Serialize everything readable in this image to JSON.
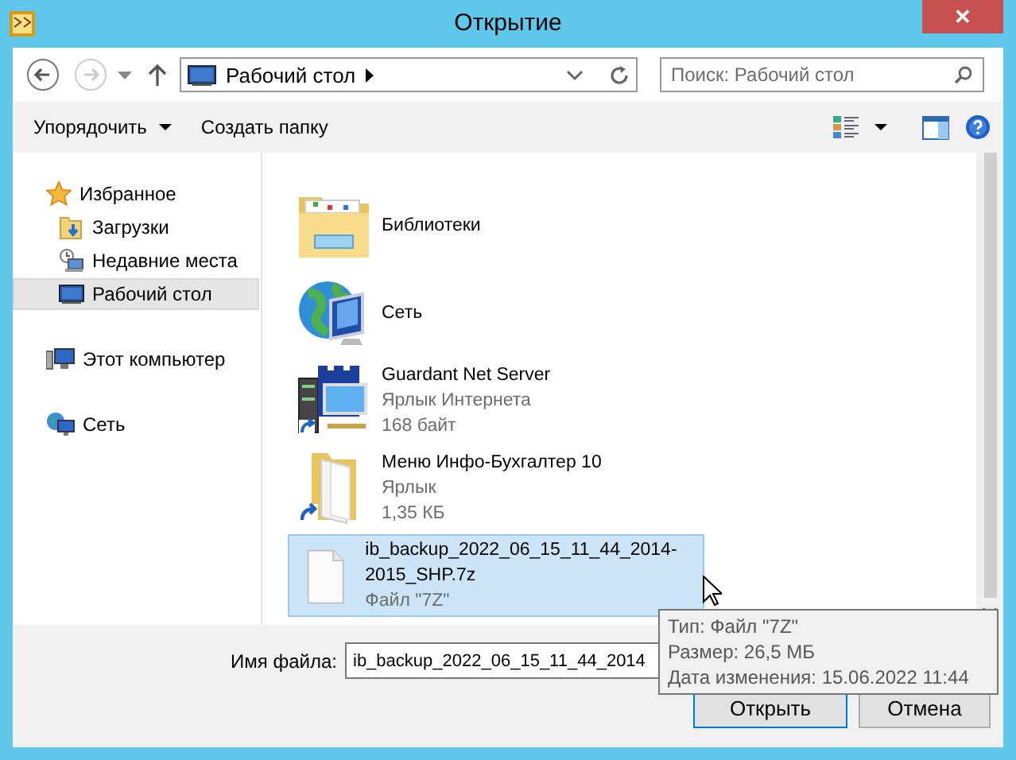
{
  "window": {
    "title": "Открытие",
    "close": "✕"
  },
  "nav": {
    "path": "Рабочий стол",
    "search": {
      "placeholder": "Поиск: Рабочий стол"
    }
  },
  "toolbar": {
    "organize": "Упорядочить",
    "new_folder": "Создать папку"
  },
  "sidebar": [
    {
      "label": "Избранное",
      "kind": "favorites",
      "selected": false,
      "children": [
        {
          "label": "Загрузки",
          "kind": "downloads",
          "selected": false
        },
        {
          "label": "Недавние места",
          "kind": "recent",
          "selected": false
        },
        {
          "label": "Рабочий стол",
          "kind": "desktop",
          "selected": true
        }
      ]
    },
    {
      "label": "Этот компьютер",
      "kind": "computer",
      "selected": false
    },
    {
      "label": "Сеть",
      "kind": "network",
      "selected": false
    }
  ],
  "files": [
    {
      "name": "Библиотеки",
      "kind": "library",
      "selected": false
    },
    {
      "name": "Сеть",
      "kind": "network",
      "selected": false
    },
    {
      "name": "Guardant Net Server",
      "kind": "server",
      "details": [
        "Ярлык Интернета",
        "168 байт"
      ],
      "selected": false
    },
    {
      "name": "Меню Инфо-Бухгалтер 10",
      "kind": "shortcut",
      "details": [
        "Ярлык",
        "1,35 КБ"
      ],
      "selected": false
    },
    {
      "name": "ib_backup_2022_06_15_11_44_2014-2015_SHP.7z",
      "kind": "file",
      "details": [
        "Файл \"7Z\""
      ],
      "selected": true
    }
  ],
  "footer": {
    "filename_label": "Имя файла:",
    "filename": "ib_backup_2022_06_15_11_44_2014",
    "open": "Открыть",
    "cancel": "Отмена"
  },
  "tooltip": [
    "Тип: Файл \"7Z\"",
    "Размер: 26,5 МБ",
    "Дата изменения: 15.06.2022 11:44"
  ]
}
